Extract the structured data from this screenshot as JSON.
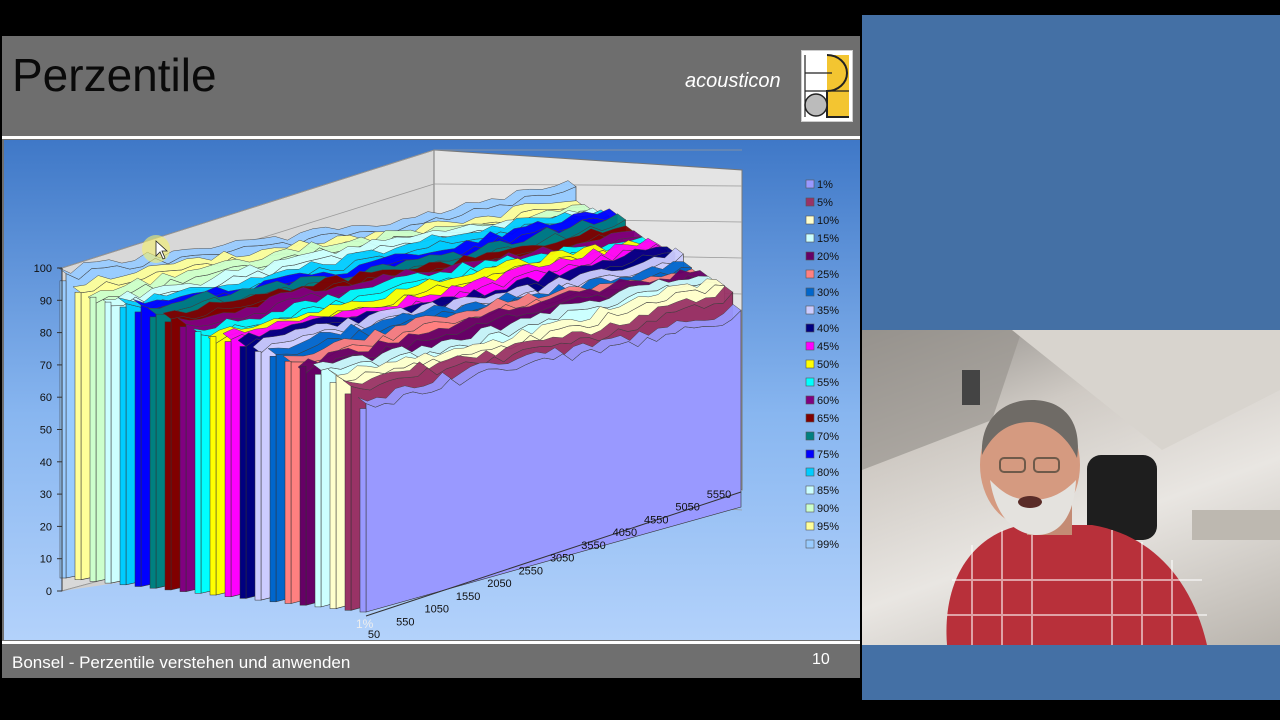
{
  "slide": {
    "title": "Perzentile",
    "brand": "acousticon",
    "footer": "Bonsel  - Perzentile verstehen und anwenden",
    "page_number": "10"
  },
  "colors": {
    "background": "#4470a5",
    "slide_bg": "#6f6f6f",
    "logo_yellow": "#f3c531"
  },
  "chart_data": {
    "type": "area",
    "title": "",
    "xlabel": "",
    "ylabel": "",
    "ylim": [
      0,
      100
    ],
    "y_ticks": [
      "0",
      "10",
      "20",
      "30",
      "40",
      "50",
      "60",
      "70",
      "80",
      "90",
      "100"
    ],
    "x_ticks": [
      "50",
      "550",
      "1050",
      "1550",
      "2050",
      "2550",
      "3050",
      "3550",
      "4050",
      "4550",
      "5050",
      "5550"
    ],
    "grid": true,
    "legend_position": "right",
    "series": [
      {
        "name": "1%",
        "color": "#9999ff",
        "level": 63
      },
      {
        "name": "5%",
        "color": "#993366",
        "level": 67
      },
      {
        "name": "10%",
        "color": "#ffffcc",
        "level": 70
      },
      {
        "name": "15%",
        "color": "#ccffff",
        "level": 72
      },
      {
        "name": "20%",
        "color": "#660066",
        "level": 74
      },
      {
        "name": "25%",
        "color": "#ff8080",
        "level": 75
      },
      {
        "name": "30%",
        "color": "#0066cc",
        "level": 76
      },
      {
        "name": "35%",
        "color": "#ccccff",
        "level": 77
      },
      {
        "name": "40%",
        "color": "#000080",
        "level": 78
      },
      {
        "name": "45%",
        "color": "#ff00ff",
        "level": 79
      },
      {
        "name": "50%",
        "color": "#ffff00",
        "level": 80
      },
      {
        "name": "55%",
        "color": "#00ffff",
        "level": 81
      },
      {
        "name": "60%",
        "color": "#800080",
        "level": 82
      },
      {
        "name": "65%",
        "color": "#800000",
        "level": 83
      },
      {
        "name": "70%",
        "color": "#008080",
        "level": 84
      },
      {
        "name": "75%",
        "color": "#0000ff",
        "level": 85
      },
      {
        "name": "80%",
        "color": "#00ccff",
        "level": 86
      },
      {
        "name": "85%",
        "color": "#ccffff",
        "level": 87
      },
      {
        "name": "90%",
        "color": "#ccffcc",
        "level": 88
      },
      {
        "name": "95%",
        "color": "#ffff99",
        "level": 89
      },
      {
        "name": "99%",
        "color": "#99ccff",
        "level": 92
      }
    ]
  },
  "front_label": "1%"
}
